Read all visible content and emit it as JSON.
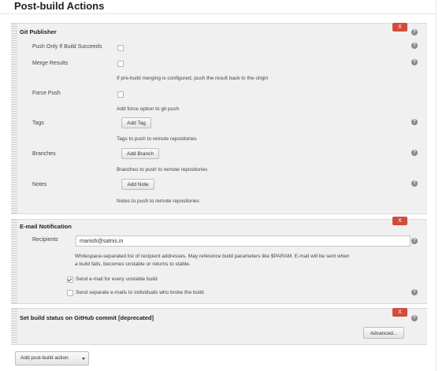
{
  "page_title": "Post-build Actions",
  "git_publisher": {
    "title": "Git Publisher",
    "delete_label": "X",
    "push_only_label": "Push Only If Build Succeeds",
    "merge_results_label": "Merge Results",
    "merge_results_desc": "If pre-build merging is configured, push the result back to the origin",
    "force_push_label": "Force Push",
    "force_push_desc": "Add force option to git push",
    "tags_label": "Tags",
    "add_tag_label": "Add Tag",
    "tags_desc": "Tags to push to remote repositories",
    "branches_label": "Branches",
    "add_branch_label": "Add Branch",
    "branches_desc": "Branches to push to remote repositories",
    "notes_label": "Notes",
    "add_note_label": "Add Note",
    "notes_desc": "Notes to push to remote repositories"
  },
  "email_notification": {
    "title": "E-mail Notification",
    "delete_label": "X",
    "recipients_label": "Recipients",
    "recipients_value": "manish@satnis.in",
    "recipients_desc_1": "Whitespace-separated list of recipient addresses. May reference build parameters like $PARAM. E-mail will be sent when",
    "recipients_desc_2": "a build fails, becomes unstable or returns to stable.",
    "every_unstable_label": "Send e-mail for every unstable build",
    "every_unstable_checked": true,
    "separate_emails_label": "Send separate e-mails to individuals who broke the build",
    "separate_emails_checked": false
  },
  "github_status": {
    "title": "Set build status on GitHub commit [deprecated]",
    "delete_label": "X",
    "advanced_label": "Advanced..."
  },
  "add_post_build_label": "Add post-build action",
  "help_glyph": "?",
  "colors": {
    "delete": "#d24c3b",
    "section_bg": "#f0f0f0"
  }
}
